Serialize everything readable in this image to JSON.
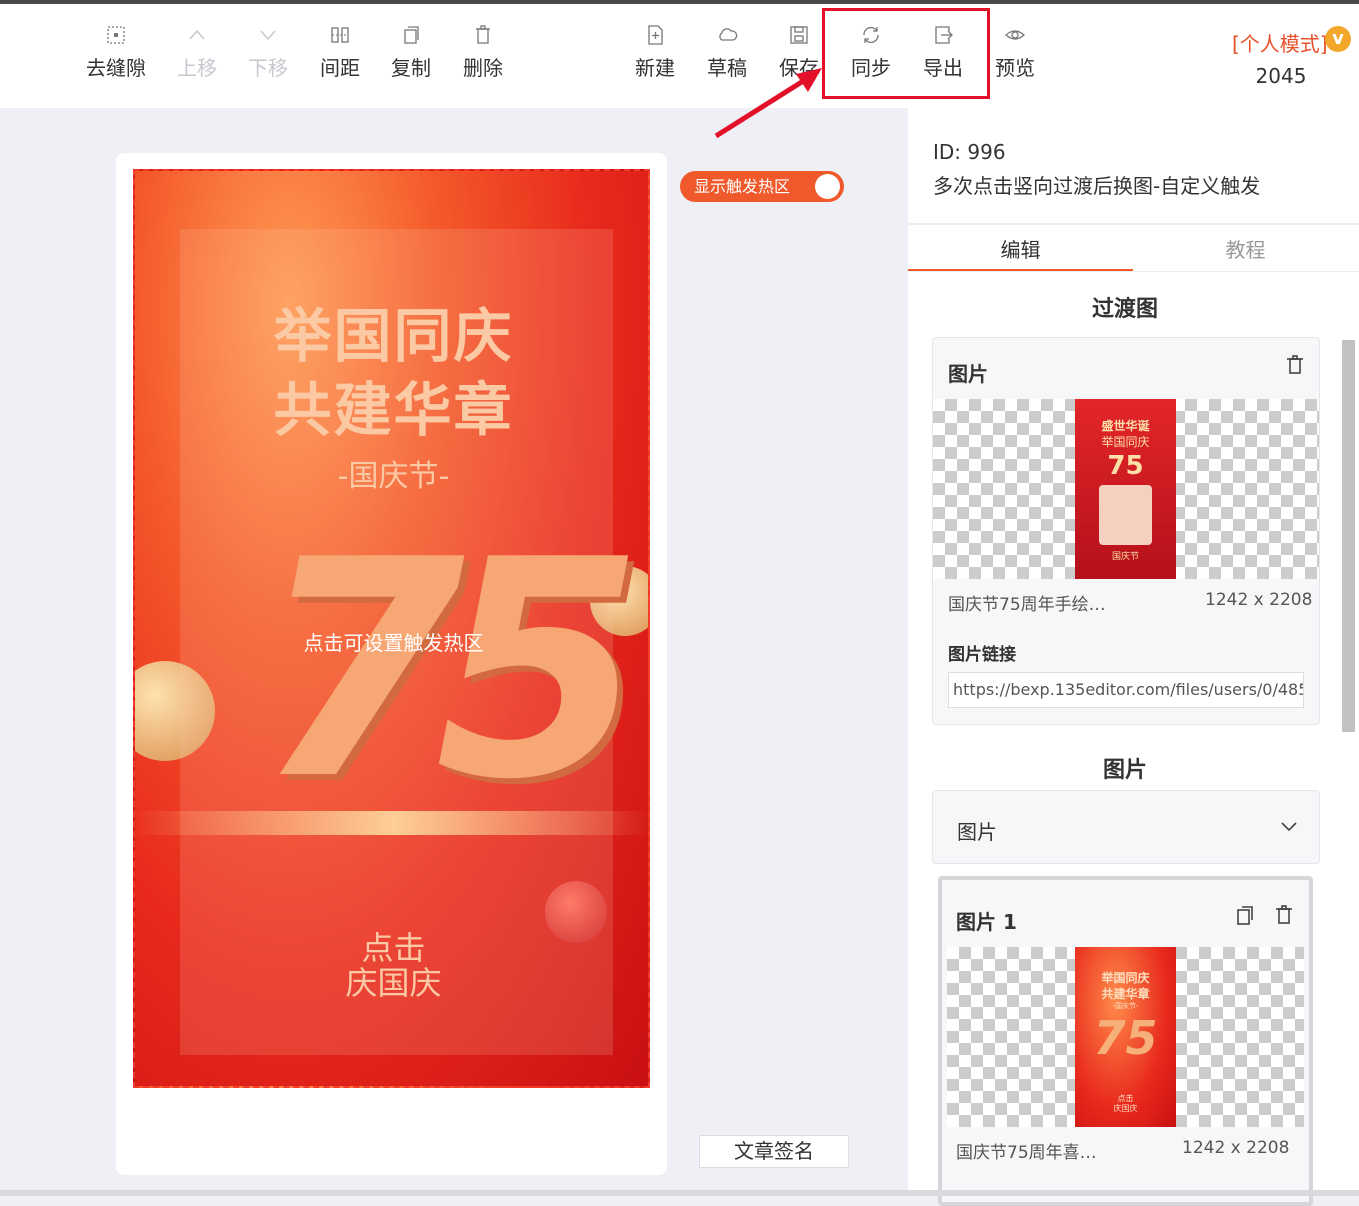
{
  "toolbar": {
    "items": [
      {
        "label": "去缝隙",
        "icon": "grid-icon",
        "disabled": false
      },
      {
        "label": "上移",
        "icon": "chevron-up-icon",
        "disabled": true
      },
      {
        "label": "下移",
        "icon": "chevron-down-icon",
        "disabled": true
      },
      {
        "label": "间距",
        "icon": "spacing-icon",
        "disabled": false
      },
      {
        "label": "复制",
        "icon": "copy-icon",
        "disabled": false
      },
      {
        "label": "删除",
        "icon": "trash-icon",
        "disabled": false
      },
      {
        "label": "新建",
        "icon": "new-file-icon",
        "disabled": false
      },
      {
        "label": "草稿",
        "icon": "cloud-icon",
        "disabled": false
      },
      {
        "label": "保存",
        "icon": "save-icon",
        "disabled": false
      },
      {
        "label": "同步",
        "icon": "sync-icon",
        "disabled": false
      },
      {
        "label": "导出",
        "icon": "export-icon",
        "disabled": false
      },
      {
        "label": "预览",
        "icon": "eye-icon",
        "disabled": false
      }
    ],
    "mode_label": "[个人模式]",
    "vip_badge": "v",
    "count": "2045"
  },
  "canvas": {
    "toggle_label": "显示触发热区",
    "toggle_on": true,
    "signature_button": "文章签名",
    "poster": {
      "line1": "举国同庆",
      "line2": "共建华章",
      "subtitle": "-国庆节-",
      "number": "75",
      "hotspot_hint": "点击可设置触发热区",
      "bottom_line1": "点击",
      "bottom_line2": "庆国庆"
    }
  },
  "panel": {
    "id_text": "ID: 996",
    "title": "多次点击竖向过渡后换图-自定义触发",
    "tabs": [
      {
        "label": "编辑",
        "active": true
      },
      {
        "label": "教程",
        "active": false
      }
    ],
    "transition_section": {
      "title": "过渡图",
      "card_head": "图片",
      "thumb": {
        "line1": "盛世华诞",
        "line2": "举国同庆",
        "number": "75",
        "footer": "国庆节"
      },
      "file_name": "国庆节75周年手绘…",
      "file_dims": "1242 x 2208",
      "link_label": "图片链接",
      "link_value": "https://bexp.135editor.com/files/users/0/485"
    },
    "image_section": {
      "title": "图片",
      "dropdown_label": "图片",
      "item_head": "图片 1",
      "thumb": {
        "line1": "举国同庆",
        "line2": "共建华章",
        "sub": "-国庆节-",
        "number": "75",
        "footer1": "点击",
        "footer2": "庆国庆"
      },
      "file_name": "国庆节75周年喜…",
      "file_dims": "1242 x 2208"
    }
  },
  "colors": {
    "accent": "#f0592b",
    "highlight_box": "#e3102a",
    "mode_text": "#e8512c",
    "vip": "#f2a72b"
  }
}
